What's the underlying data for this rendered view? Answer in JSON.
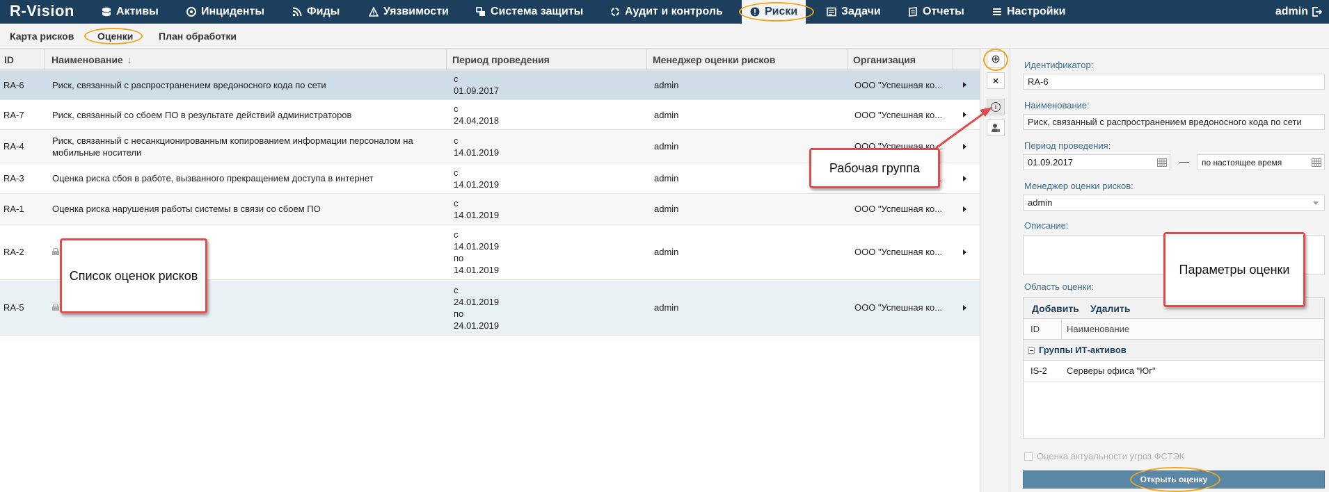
{
  "app": {
    "logo": "R-Vision"
  },
  "nav": {
    "items": [
      {
        "label": "Активы",
        "icon": "database-icon"
      },
      {
        "label": "Инциденты",
        "icon": "target-icon"
      },
      {
        "label": "Фиды",
        "icon": "rss-icon"
      },
      {
        "label": "Уязвимости",
        "icon": "warning-icon"
      },
      {
        "label": "Система защиты",
        "icon": "windows-icon"
      },
      {
        "label": "Аудит и контроль",
        "icon": "cycle-icon"
      },
      {
        "label": "Риски",
        "icon": "alert-circle-icon",
        "active": true
      },
      {
        "label": "Задачи",
        "icon": "tasks-icon"
      },
      {
        "label": "Отчеты",
        "icon": "reports-icon"
      },
      {
        "label": "Настройки",
        "icon": "menu-icon"
      }
    ],
    "user": "admin"
  },
  "subnav": {
    "items": [
      "Карта рисков",
      "Оценки",
      "План обработки"
    ],
    "active": "Оценки"
  },
  "table": {
    "columns": [
      "ID",
      "Наименование",
      "Период проведения",
      "Менеджер оценки рисков",
      "Организация"
    ],
    "sort_indicator": "↓",
    "rows": [
      {
        "id": "RA-6",
        "name": "Риск, связанный с распространением вредоносного кода по сети",
        "period": [
          "с",
          "01.09.2017"
        ],
        "manager": "admin",
        "org": "ООО \"Успешная ко...",
        "selected": true
      },
      {
        "id": "RA-7",
        "name": "Риск, связанный со сбоем ПО в результате действий администраторов",
        "period": [
          "с",
          "24.04.2018"
        ],
        "manager": "admin",
        "org": "ООО \"Успешная ко..."
      },
      {
        "id": "RA-4",
        "name": "Риск, связанный с несанкционированным копированием информации персоналом на мобильные носители",
        "period": [
          "с",
          "14.01.2019"
        ],
        "manager": "admin",
        "org": "ООО \"Успешная ко..."
      },
      {
        "id": "RA-3",
        "name": "Оценка риска сбоя в работе, вызванного прекращением доступа в интернет",
        "period": [
          "с",
          "14.01.2019"
        ],
        "manager": "admin",
        "org": "ООО \"Успешная ко..."
      },
      {
        "id": "RA-1",
        "name": "Оценка риска нарушения работы системы в связи со сбоем ПО",
        "period": [
          "с",
          "14.01.2019"
        ],
        "manager": "admin",
        "org": "ООО \"Успешная ко..."
      },
      {
        "id": "RA-2",
        "name": "",
        "period": [
          "с",
          "14.01.2019",
          "по",
          "14.01.2019"
        ],
        "manager": "admin",
        "org": "ООО \"Успешная ко...",
        "locked": true
      },
      {
        "id": "RA-5",
        "name": "",
        "period": [
          "с",
          "24.01.2019",
          "по",
          "24.01.2019"
        ],
        "manager": "admin",
        "org": "ООО \"Успешная ко...",
        "locked": true
      }
    ]
  },
  "toolbar": {
    "add": "⊕",
    "close": "×",
    "info": "i",
    "team": "team-icon"
  },
  "form": {
    "id_label": "Идентификатор:",
    "id_value": "RA-6",
    "name_label": "Наименование:",
    "name_value": "Риск, связанный с распространением вредоносного кода по сети",
    "period_label": "Период проведения:",
    "period_from": "01.09.2017",
    "period_dash": "—",
    "period_to": "по настоящее время",
    "manager_label": "Менеджер оценки рисков:",
    "manager_value": "admin",
    "desc_label": "Описание:",
    "scope_label": "Область оценки:",
    "scope_add": "Добавить",
    "scope_delete": "Удалить",
    "scope_col_id": "ID",
    "scope_col_name": "Наименование",
    "scope_group": "Группы ИТ-активов",
    "scope_rows": [
      {
        "id": "IS-2",
        "name": "Серверы офиса \"Юг\""
      }
    ],
    "fstek_label": "Оценка актуальности угроз ФСТЭК",
    "open_button": "Открыть оценку"
  },
  "callouts": {
    "list": "Список оценок рисков",
    "team": "Рабочая группа",
    "params": "Параметры оценки"
  },
  "colors": {
    "topbar": "#1c3f5e",
    "highlight": "#f2a51e",
    "callout_border": "#e24b4b",
    "selected_row": "#cfdee6",
    "primary_button": "#5b87a6"
  }
}
